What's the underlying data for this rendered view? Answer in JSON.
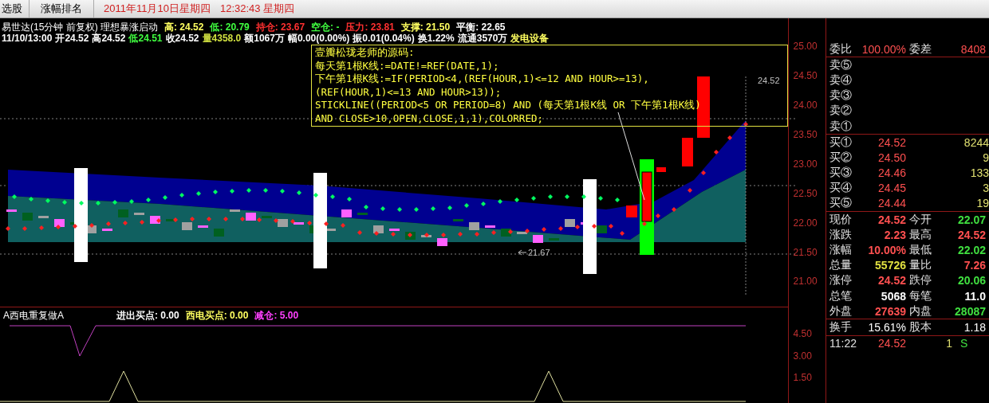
{
  "top_bar": {
    "tabs": [
      {
        "label": "选股",
        "selected": false
      },
      {
        "label": "涨幅排名",
        "selected": false
      }
    ],
    "date": "2011年11月10日星期四",
    "time": "12:32:43 星期四"
  },
  "chart": {
    "title": "易世达(15分钟 前复权) 理想暴涨启动",
    "stats": [
      {
        "text": "高: 24.52",
        "color": "#ffff60"
      },
      {
        "text": "低: 20.79",
        "color": "#40ff40"
      },
      {
        "text": "持仓: 23.67",
        "color": "#ff3030"
      },
      {
        "text": "空仓: -",
        "color": "#40ff40"
      },
      {
        "text": "压力: 23.81",
        "color": "#ff3030"
      },
      {
        "text": "支撑: 21.50",
        "color": "#ffff60"
      },
      {
        "text": "平衡: 22.65",
        "color": "#ffffff"
      }
    ],
    "bar_info": [
      {
        "text": "11/10/13:00",
        "color": "#ffffff"
      },
      {
        "text": "开24.52",
        "color": "#ffffff"
      },
      {
        "text": "高24.52",
        "color": "#ffffff"
      },
      {
        "text": "低24.51",
        "color": "#40ff40"
      },
      {
        "text": "收24.52",
        "color": "#ffffff"
      },
      {
        "text": "量4358.0",
        "color": "#d0e040"
      },
      {
        "text": "额1067万",
        "color": "#ffffff"
      },
      {
        "text": "幅0.00(0.00%)",
        "color": "#ffffff"
      },
      {
        "text": "振0.01(0.04%)",
        "color": "#ffffff"
      },
      {
        "text": "换1.22%",
        "color": "#ffffff"
      },
      {
        "text": "流通3570万",
        "color": "#ffffff"
      },
      {
        "text": "发电设备",
        "color": "#ffff60"
      }
    ],
    "formula_lines": [
      "壹瓣松珑老师的源码:",
      "每天第1根K线:=DATE!=REF(DATE,1);",
      "下午第1根K线:=IF(PERIOD<4,(REF(HOUR,1)<=12 AND HOUR>=13),",
      "(REF(HOUR,1)<=13 AND HOUR>13));",
      "STICKLINE((PERIOD<5 OR PERIOD=8) AND (每天第1根K线 OR 下午第1根K线)",
      "AND CLOSE>10,OPEN,CLOSE,1,1),COLORRED;"
    ],
    "high_label": "24.52",
    "low_label": "21.67",
    "axis_labels": [
      "25.00",
      "24.50",
      "24.00",
      "23.50",
      "23.00",
      "22.50",
      "22.00",
      "21.50",
      "21.00"
    ]
  },
  "indicator": {
    "name": "A西电重复做A",
    "values": [
      {
        "text": "进出买点: 0.00",
        "color": "#ffffff"
      },
      {
        "text": "西电买点: 0.00",
        "color": "#ffff60"
      },
      {
        "text": "减仓: 5.00",
        "color": "#ff40ff"
      }
    ],
    "axis_labels": [
      "4.50",
      "3.00",
      "1.50"
    ]
  },
  "order_book": {
    "ratio_label": "委比",
    "ratio_value": "100.00%",
    "diff_label": "委差",
    "diff_value": "8408",
    "asks": [
      {
        "label": "卖⑤"
      },
      {
        "label": "卖④"
      },
      {
        "label": "卖③"
      },
      {
        "label": "卖②"
      },
      {
        "label": "卖①"
      }
    ],
    "bids": [
      {
        "label": "买①",
        "price": "24.52",
        "volume": "8244"
      },
      {
        "label": "买②",
        "price": "24.50",
        "volume": "9"
      },
      {
        "label": "买③",
        "price": "24.46",
        "volume": "133"
      },
      {
        "label": "买④",
        "price": "24.45",
        "volume": "3"
      },
      {
        "label": "买⑤",
        "price": "24.44",
        "volume": "19"
      }
    ]
  },
  "quote": [
    {
      "cells": [
        {
          "label": "现价",
          "value": "24.52",
          "color": "#ff5050"
        },
        {
          "label": "今开",
          "value": "22.07",
          "color": "#40e040"
        }
      ]
    },
    {
      "cells": [
        {
          "label": "涨跌",
          "value": "2.23",
          "color": "#ff5050"
        },
        {
          "label": "最高",
          "value": "24.52",
          "color": "#ff5050"
        }
      ]
    },
    {
      "cells": [
        {
          "label": "涨幅",
          "value": "10.00%",
          "color": "#ff5050"
        },
        {
          "label": "最低",
          "value": "22.02",
          "color": "#40e040"
        }
      ]
    },
    {
      "cells": [
        {
          "label": "总量",
          "value": "55726",
          "color": "#e0e040"
        },
        {
          "label": "量比",
          "value": "7.26",
          "color": "#ff5050"
        }
      ]
    },
    {
      "cells": [
        {
          "label": "涨停",
          "value": "24.52",
          "color": "#ff5050"
        },
        {
          "label": "跌停",
          "value": "20.06",
          "color": "#40e040"
        }
      ]
    },
    {
      "cells": [
        {
          "label": "总笔",
          "value": "5068",
          "color": "#ffffff"
        },
        {
          "label": "每笔",
          "value": "11.0",
          "color": "#ffffff"
        }
      ]
    },
    {
      "cells": [
        {
          "label": "外盘",
          "value": "27639",
          "color": "#ff5050"
        },
        {
          "label": "内盘",
          "value": "28087",
          "color": "#40e040"
        }
      ]
    }
  ],
  "turnover": {
    "label": "换手",
    "value": "15.61%",
    "label2": "股本",
    "value2": "1.18"
  },
  "ticks": [
    {
      "time": "11:22",
      "price": "24.52",
      "volume": "1",
      "side": "S"
    }
  ]
}
